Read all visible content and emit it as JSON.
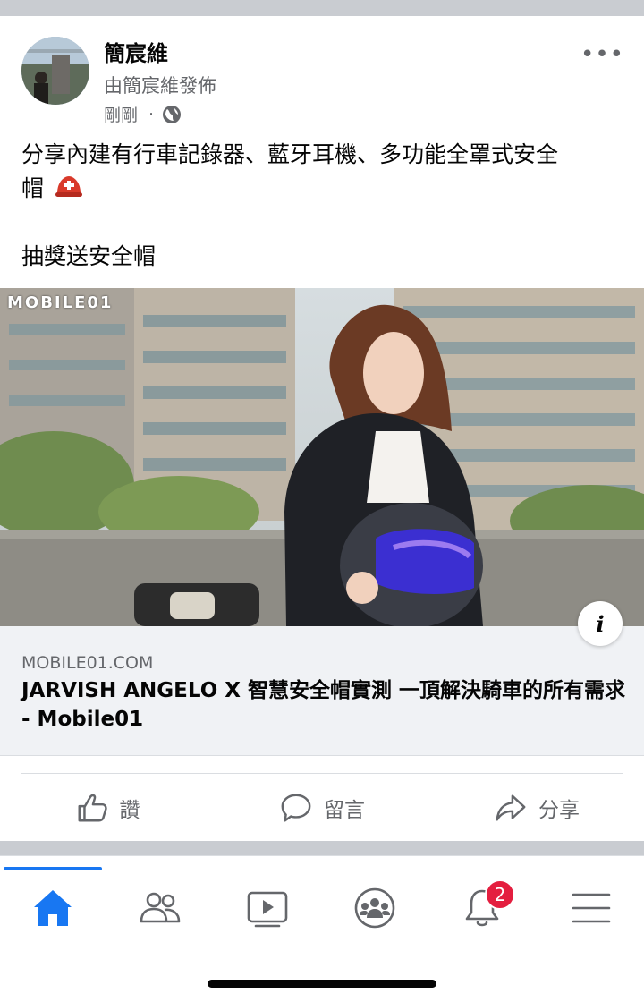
{
  "post": {
    "author": "簡宸維",
    "posted_by": "由簡宸維發佈",
    "time": "剛剛",
    "separator": "·",
    "privacy_icon": "globe-icon",
    "more_icon": "more-options-icon",
    "more_label": "•••",
    "text_line1": "分享內建有行車記錄器、藍牙耳機、多功能全罩式安全",
    "text_line2": "帽",
    "text_emoji": "⛑",
    "text_line3": "抽獎送安全帽"
  },
  "link": {
    "watermark": "MOBILE01",
    "info_label": "i",
    "domain": "MOBILE01.COM",
    "title": "JARVISH ANGELO X 智慧安全帽實測 一頂解決騎車的所有需求 - Mobile01"
  },
  "actions": [
    {
      "label": "讚",
      "icon": "like-icon"
    },
    {
      "label": "留言",
      "icon": "comment-icon"
    },
    {
      "label": "分享",
      "icon": "share-icon"
    }
  ],
  "tabbar": {
    "tabs": [
      {
        "name": "home",
        "icon": "home-icon",
        "active": true
      },
      {
        "name": "friends",
        "icon": "friends-icon"
      },
      {
        "name": "watch",
        "icon": "video-icon"
      },
      {
        "name": "groups",
        "icon": "groups-icon"
      },
      {
        "name": "notifications",
        "icon": "bell-icon",
        "badge": "2"
      },
      {
        "name": "menu",
        "icon": "menu-icon"
      }
    ]
  },
  "colors": {
    "accent": "#1877f2",
    "badge": "#e41e3f",
    "secondary_text": "#65676b",
    "link_bg": "#f0f2f5"
  }
}
